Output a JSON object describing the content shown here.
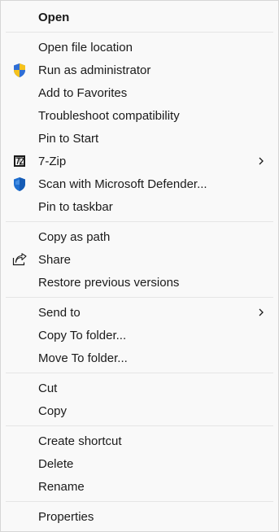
{
  "menu": {
    "groups": [
      [
        {
          "label": "Open",
          "bold": true,
          "icon": null,
          "submenu": false
        }
      ],
      [
        {
          "label": "Open file location",
          "icon": null,
          "submenu": false
        },
        {
          "label": "Run as administrator",
          "icon": "uac-shield-icon",
          "submenu": false
        },
        {
          "label": "Add to Favorites",
          "icon": null,
          "submenu": false
        },
        {
          "label": "Troubleshoot compatibility",
          "icon": null,
          "submenu": false
        },
        {
          "label": "Pin to Start",
          "icon": null,
          "submenu": false
        },
        {
          "label": "7-Zip",
          "icon": "7zip-icon",
          "submenu": true
        },
        {
          "label": "Scan with Microsoft Defender...",
          "icon": "defender-shield-icon",
          "submenu": false
        },
        {
          "label": "Pin to taskbar",
          "icon": null,
          "submenu": false
        }
      ],
      [
        {
          "label": "Copy as path",
          "icon": null,
          "submenu": false
        },
        {
          "label": "Share",
          "icon": "share-icon",
          "submenu": false
        },
        {
          "label": "Restore previous versions",
          "icon": null,
          "submenu": false
        }
      ],
      [
        {
          "label": "Send to",
          "icon": null,
          "submenu": true
        },
        {
          "label": "Copy To folder...",
          "icon": null,
          "submenu": false
        },
        {
          "label": "Move To folder...",
          "icon": null,
          "submenu": false
        }
      ],
      [
        {
          "label": "Cut",
          "icon": null,
          "submenu": false
        },
        {
          "label": "Copy",
          "icon": null,
          "submenu": false
        }
      ],
      [
        {
          "label": "Create shortcut",
          "icon": null,
          "submenu": false
        },
        {
          "label": "Delete",
          "icon": null,
          "submenu": false
        },
        {
          "label": "Rename",
          "icon": null,
          "submenu": false
        }
      ],
      [
        {
          "label": "Properties",
          "icon": null,
          "submenu": false
        }
      ]
    ]
  },
  "colors": {
    "background": "#f9f9f9",
    "separator": "#e5e5e5",
    "text": "#1a1a1a",
    "uac_blue": "#2f6fd6",
    "uac_yellow": "#f6c21c",
    "defender_blue": "#1f6fd0"
  }
}
